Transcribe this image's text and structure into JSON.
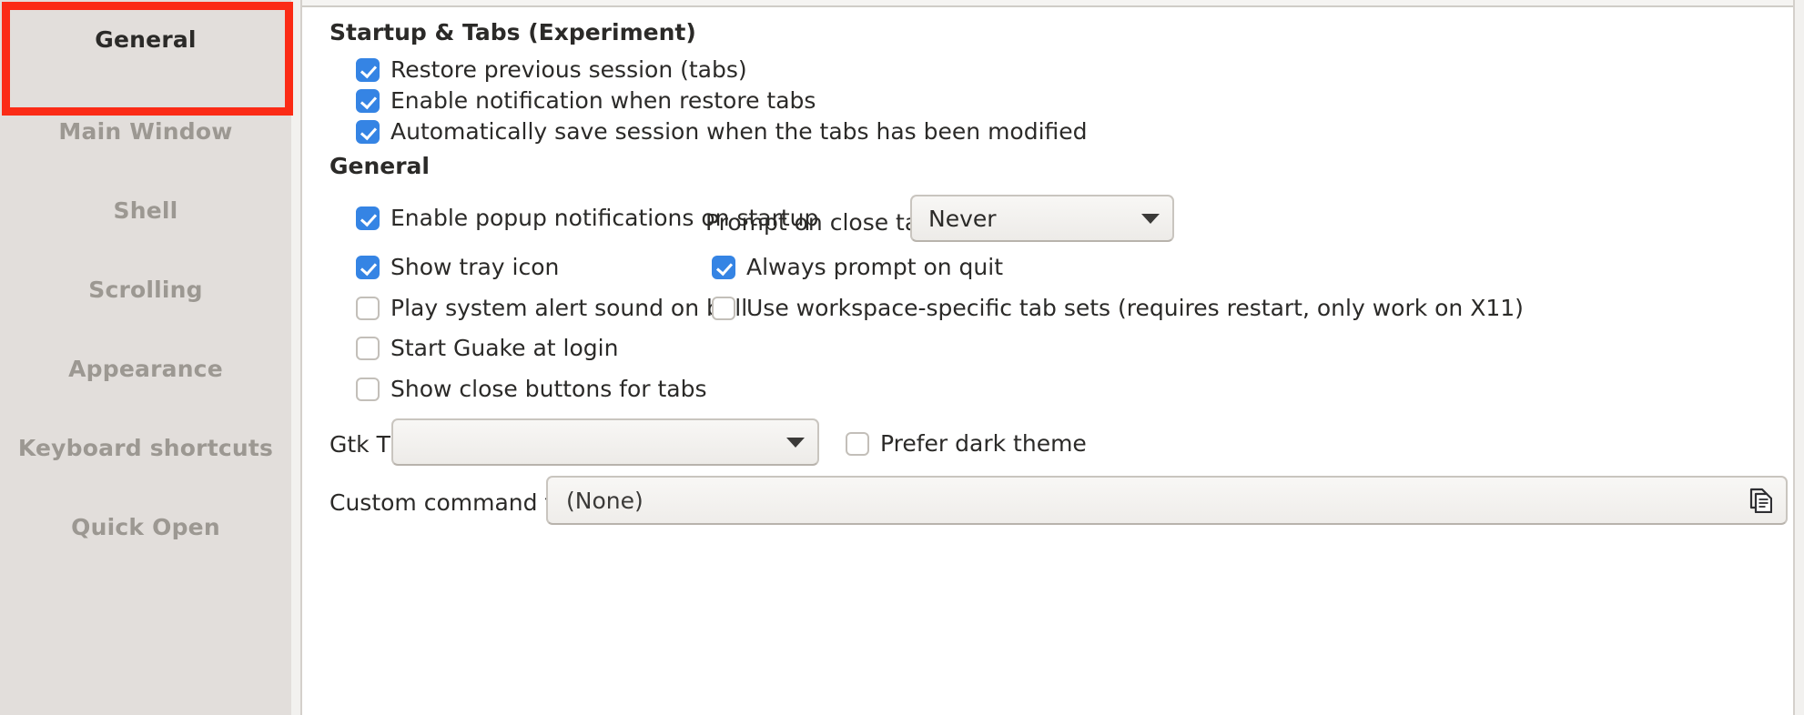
{
  "sidebar": {
    "items": [
      {
        "label": "General",
        "selected": true
      },
      {
        "label": "Main Window",
        "selected": false
      },
      {
        "label": "Shell",
        "selected": false
      },
      {
        "label": "Scrolling",
        "selected": false
      },
      {
        "label": "Appearance",
        "selected": false
      },
      {
        "label": "Keyboard shortcuts",
        "selected": false
      },
      {
        "label": "Quick Open",
        "selected": false
      }
    ],
    "accent_color": "#3584e4",
    "highlight_color": "#fb2b16"
  },
  "content": {
    "startup_section": {
      "title": "Startup & Tabs (Experiment)",
      "checkboxes": [
        {
          "label": "Restore previous session (tabs)",
          "checked": true
        },
        {
          "label": "Enable notification when restore tabs",
          "checked": true
        },
        {
          "label": "Automatically save session when the tabs has been modified",
          "checked": true
        }
      ]
    },
    "general_section": {
      "title": "General",
      "left_checkboxes": [
        {
          "label": "Enable popup notifications on startup",
          "checked": true
        },
        {
          "label": "Show tray icon",
          "checked": true
        },
        {
          "label": "Play system alert sound on bell",
          "checked": false
        },
        {
          "label": "Start Guake at login",
          "checked": false
        },
        {
          "label": "Show close buttons for tabs",
          "checked": false
        }
      ],
      "prompt_on_close_tab": {
        "label": "Prompt on close tab:",
        "value": "Never"
      },
      "right_checkboxes": [
        {
          "label": "Always prompt on quit",
          "checked": true
        },
        {
          "label": "Use workspace-specific tab sets (requires restart, only work on X11)",
          "checked": false
        }
      ],
      "gtk_theme": {
        "label": "Gtk Theme:",
        "value": ""
      },
      "prefer_dark_theme": {
        "label": "Prefer dark theme",
        "checked": false
      },
      "custom_command_file_path": {
        "label": "Custom command file path:",
        "value": "(None)",
        "browse_icon": "copy-document-icon"
      }
    }
  }
}
